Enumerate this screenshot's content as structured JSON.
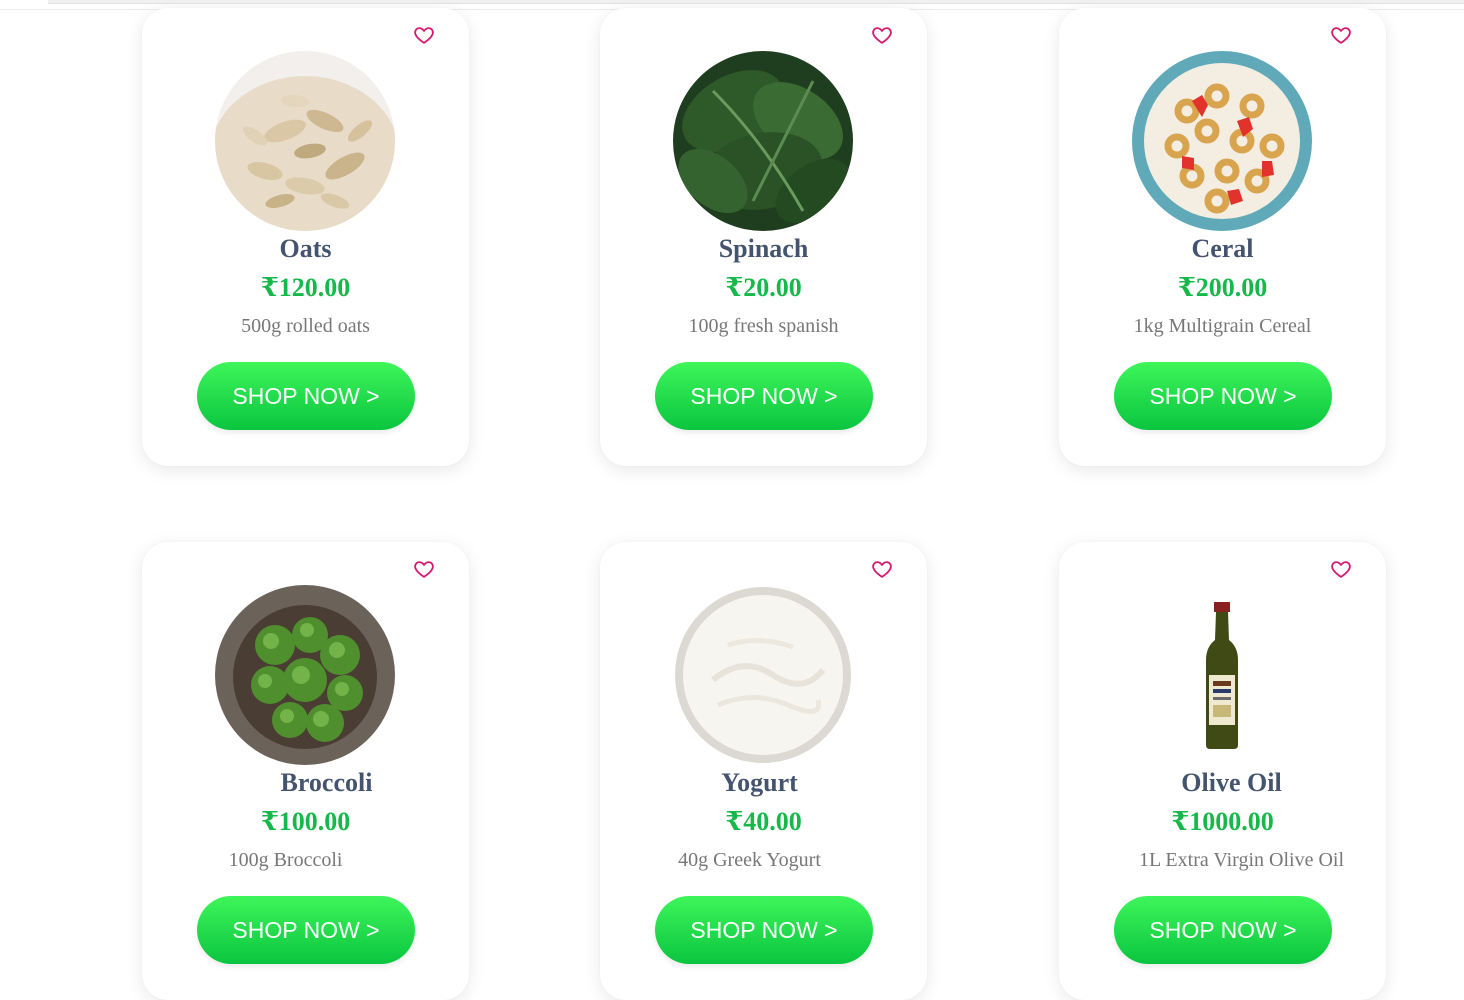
{
  "colors": {
    "title": "#44546e",
    "price": "#16b84a",
    "description": "#777777",
    "button_gradient_top": "#3ef55a",
    "button_gradient_bottom": "#0ac53f",
    "heart": "#d6186f"
  },
  "products": [
    {
      "name": "Oats",
      "price": "₹120.00",
      "description": "500g rolled oats",
      "button": "SHOP NOW >",
      "icon": "heart-icon"
    },
    {
      "name": "Spinach",
      "price": "₹20.00",
      "description": "100g fresh spanish",
      "button": "SHOP NOW >",
      "icon": "heart-icon"
    },
    {
      "name": "Ceral",
      "price": "₹200.00",
      "description": "1kg Multigrain Cereal",
      "button": "SHOP NOW >",
      "icon": "heart-icon"
    },
    {
      "name": "Broccoli",
      "price": "₹100.00",
      "description": "100g Broccoli",
      "button": "SHOP NOW >",
      "icon": "heart-icon"
    },
    {
      "name": "Yogurt",
      "price": "₹40.00",
      "description": "40g Greek Yogurt",
      "button": "SHOP NOW >",
      "icon": "heart-icon"
    },
    {
      "name": "Olive Oil",
      "price": "₹1000.00",
      "description": "1L Extra Virgin Olive Oil",
      "button": "SHOP NOW >",
      "icon": "heart-icon"
    }
  ]
}
